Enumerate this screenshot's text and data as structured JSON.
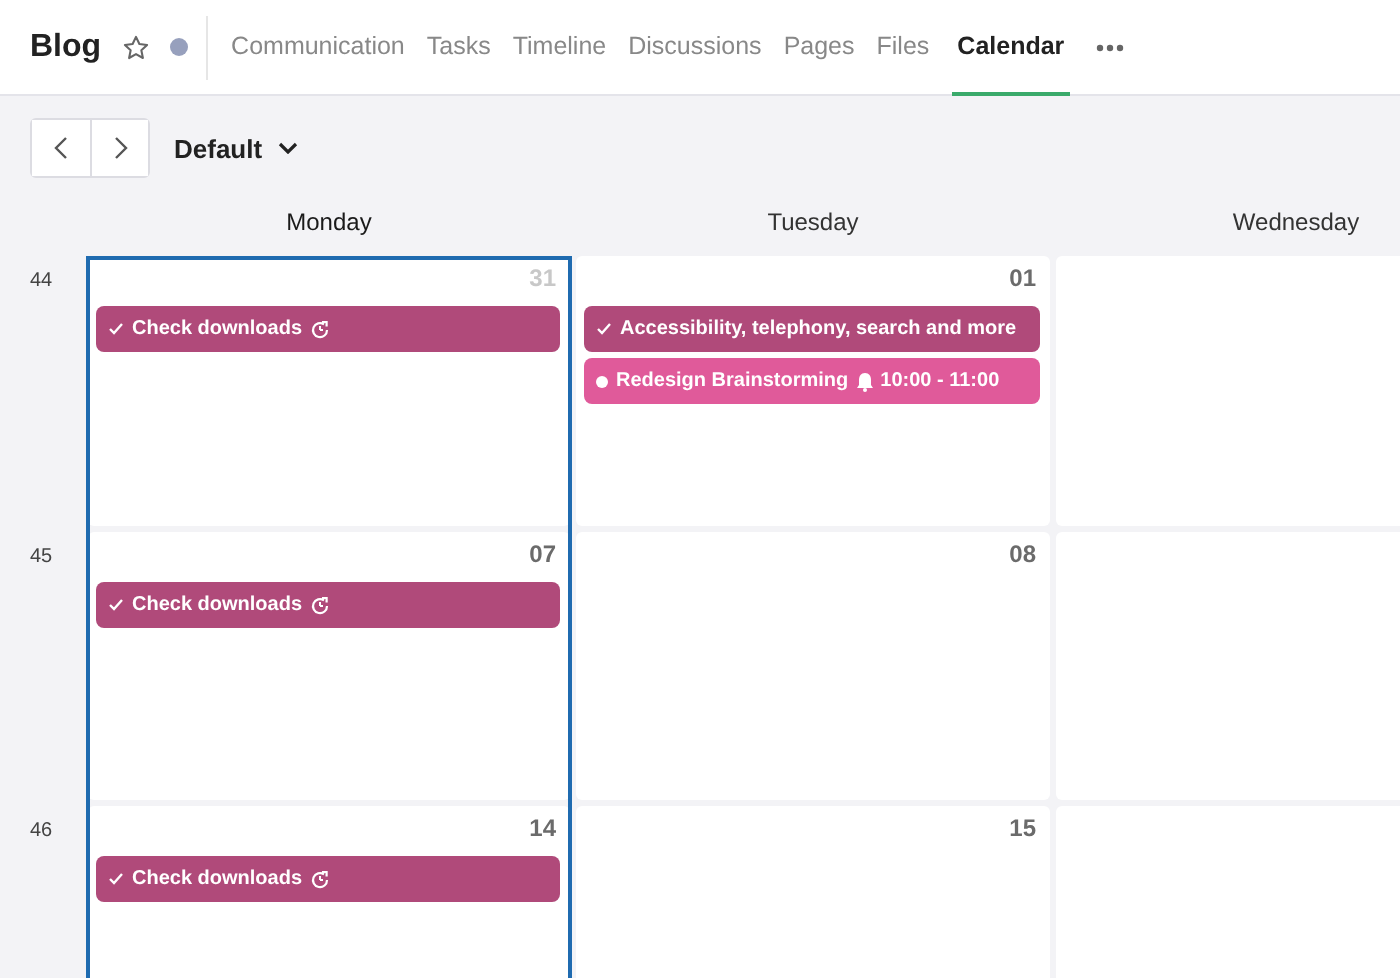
{
  "header": {
    "title": "Blog",
    "tabs": [
      {
        "label": "Communication",
        "selected": false
      },
      {
        "label": "Tasks",
        "selected": false
      },
      {
        "label": "Timeline",
        "selected": false
      },
      {
        "label": "Discussions",
        "selected": false
      },
      {
        "label": "Pages",
        "selected": false
      },
      {
        "label": "Files",
        "selected": false
      },
      {
        "label": "Calendar",
        "selected": true
      }
    ]
  },
  "toolbar": {
    "view": "Default"
  },
  "days": [
    {
      "name": "Monday",
      "selected": true
    },
    {
      "name": "Tuesday",
      "selected": false
    },
    {
      "name": "Wednesday",
      "selected": false
    }
  ],
  "weeks": [
    {
      "number": "44",
      "cells": [
        {
          "date": "31",
          "outside_month": true,
          "events": [
            {
              "kind": "task",
              "title": "Check downloads",
              "color": "#b04a7a",
              "recurring": true
            }
          ]
        },
        {
          "date": "01",
          "outside_month": false,
          "events": [
            {
              "kind": "task",
              "title": "Accessibility, telephony, search and more",
              "color": "#b04a7a",
              "recurring": false
            },
            {
              "kind": "event",
              "title": "Redesign Brainstorming",
              "color": "#e05a9a",
              "time": "10:00 - 11:00"
            }
          ]
        },
        {}
      ]
    },
    {
      "number": "45",
      "cells": [
        {
          "date": "07",
          "outside_month": false,
          "events": [
            {
              "kind": "task",
              "title": "Check downloads",
              "color": "#b04a7a",
              "recurring": true
            }
          ]
        },
        {
          "date": "08",
          "outside_month": false
        },
        {}
      ]
    },
    {
      "number": "46",
      "cells": [
        {
          "date": "14",
          "outside_month": false,
          "events": [
            {
              "kind": "task",
              "title": "Check downloads",
              "color": "#b04a7a",
              "recurring": true
            }
          ]
        },
        {
          "date": "15",
          "outside_month": false
        },
        {}
      ]
    }
  ]
}
